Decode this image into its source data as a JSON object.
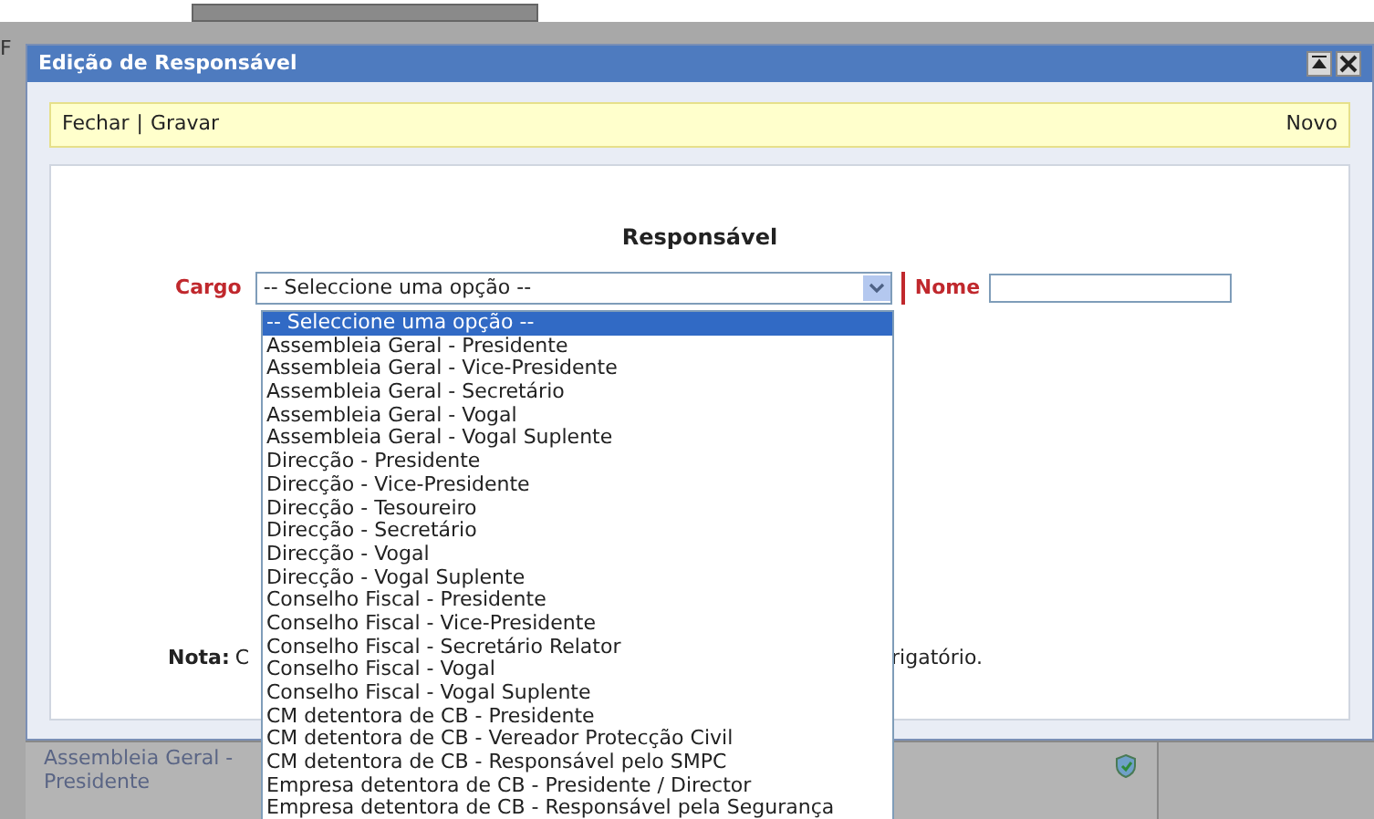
{
  "background": {
    "fragment": "F",
    "list_item": "Assembleia Geral - Presidente"
  },
  "window": {
    "title": "Edição de Responsável"
  },
  "toolbar": {
    "left_actions": [
      "Fechar",
      "Gravar"
    ],
    "separator": "|",
    "right_action": "Novo"
  },
  "form": {
    "heading": "Responsável",
    "cargo": {
      "label": "Cargo",
      "value": "-- Seleccione uma opção --",
      "expanded": true
    },
    "nome": {
      "label": "Nome"
    },
    "note": {
      "label": "Nota:",
      "text_start": "C",
      "text_end": "rigatório."
    }
  },
  "options": [
    {
      "label": "-- Seleccione uma opção --",
      "selected": true
    },
    {
      "label": "Assembleia Geral - Presidente",
      "selected": false
    },
    {
      "label": "Assembleia Geral - Vice-Presidente",
      "selected": false
    },
    {
      "label": "Assembleia Geral - Secretário",
      "selected": false
    },
    {
      "label": "Assembleia Geral - Vogal",
      "selected": false
    },
    {
      "label": "Assembleia Geral - Vogal Suplente",
      "selected": false
    },
    {
      "label": "Direcção - Presidente",
      "selected": false
    },
    {
      "label": "Direcção - Vice-Presidente",
      "selected": false
    },
    {
      "label": "Direcção - Tesoureiro",
      "selected": false
    },
    {
      "label": "Direcção - Secretário",
      "selected": false
    },
    {
      "label": "Direcção - Vogal",
      "selected": false
    },
    {
      "label": "Direcção - Vogal Suplente",
      "selected": false
    },
    {
      "label": "Conselho Fiscal - Presidente",
      "selected": false
    },
    {
      "label": "Conselho Fiscal - Vice-Presidente",
      "selected": false
    },
    {
      "label": "Conselho Fiscal - Secretário Relator",
      "selected": false
    },
    {
      "label": "Conselho Fiscal - Vogal",
      "selected": false
    },
    {
      "label": "Conselho Fiscal - Vogal Suplente",
      "selected": false
    },
    {
      "label": "CM detentora de CB - Presidente",
      "selected": false
    },
    {
      "label": "CM detentora de CB - Vereador Protecção Civil",
      "selected": false
    },
    {
      "label": "CM detentora de CB - Responsável pelo SMPC",
      "selected": false
    },
    {
      "label": "Empresa detentora de CB - Presidente / Director",
      "selected": false
    },
    {
      "label": "Empresa detentora de CB - Responsável pela Segurança",
      "selected": false
    }
  ]
}
